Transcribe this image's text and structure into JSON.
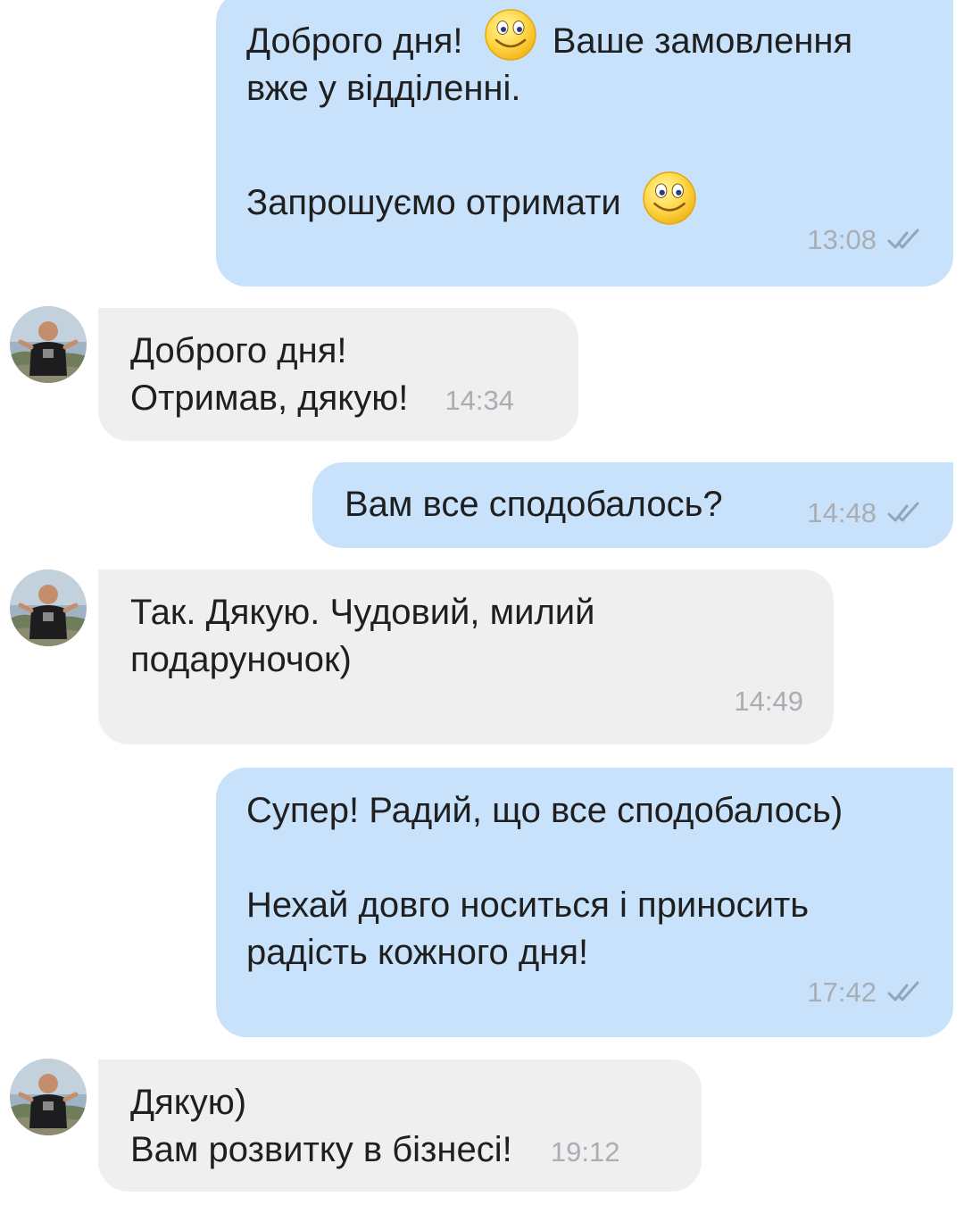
{
  "messages": [
    {
      "direction": "outgoing",
      "line1a": "Доброго дня!",
      "emoji1": "smiley-emoji",
      "line1b": "Ваше замовлення",
      "line2": "вже у відділенні.",
      "line3": "Запрошуємо отримати",
      "emoji2": "smiley-emoji",
      "time": "13:08",
      "status": "read"
    },
    {
      "direction": "incoming",
      "line1": "Доброго дня!",
      "line2": "Отримав, дякую!",
      "time": "14:34"
    },
    {
      "direction": "outgoing",
      "line1": "Вам все сподобалось?",
      "time": "14:48",
      "status": "read"
    },
    {
      "direction": "incoming",
      "line1": "Так. Дякую. Чудовий, милий",
      "line2": "подаруночок)",
      "time": "14:49"
    },
    {
      "direction": "outgoing",
      "line1": "Супер! Радий, що все сподобалось)",
      "line2": "Нехай довго носиться і приносить",
      "line3": "радість кожного дня!",
      "time": "17:42",
      "status": "read"
    },
    {
      "direction": "incoming",
      "line1": "Дякую)",
      "line2": "Вам розвитку в бізнесі!",
      "time": "19:12"
    }
  ],
  "colors": {
    "outgoing_bubble": "#c9e2fb",
    "incoming_bubble": "#efefef",
    "text": "#1f1f1f",
    "time": "#a8aeb4",
    "ticks": "#8fa6bc"
  }
}
